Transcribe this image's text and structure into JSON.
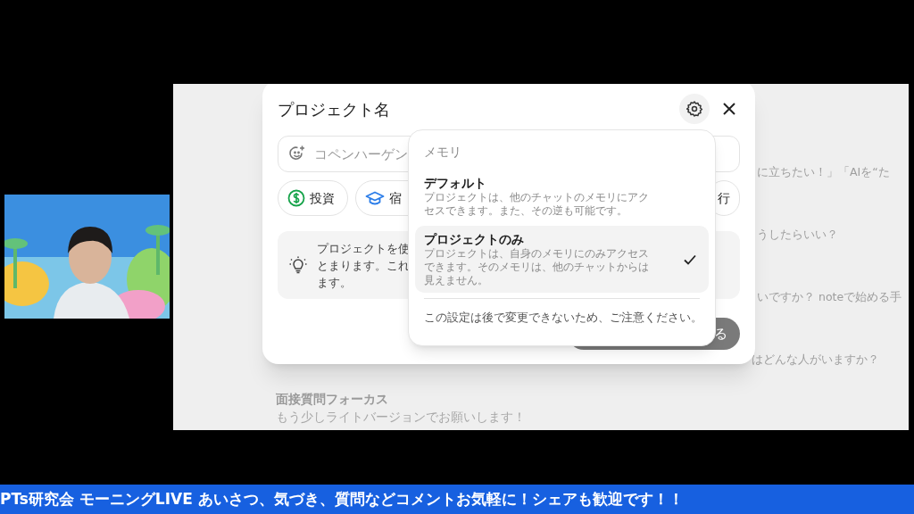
{
  "background": {
    "fragments": [
      "に立ちたい！」「AIを“た",
      "うしたらいい？",
      "いですか？ noteで始める手",
      "はどんな人がいますか？"
    ],
    "card": {
      "title": "面接質問フォーカス",
      "subtitle": "もう少しライトバージョンでお願いします！"
    }
  },
  "dialog": {
    "title": "プロジェクト名",
    "name_field": {
      "placeholder": "コペンハーゲン"
    },
    "chips": [
      {
        "kind": "money",
        "label": "投資"
      },
      {
        "kind": "school",
        "label": "宿"
      },
      {
        "kind": "plain",
        "label": "行"
      }
    ],
    "tip_lines": [
      "プロジェクトを使",
      "とまります。これ",
      "ます。"
    ],
    "create_button": "る"
  },
  "memory_menu": {
    "header": "メモリ",
    "options": [
      {
        "title": "デフォルト",
        "description": "プロジェクトは、他のチャットのメモリにアクセスできます。また、その逆も可能です。",
        "selected": false
      },
      {
        "title": "プロジェクトのみ",
        "description": "プロジェクトは、自身のメモリにのみアクセスできます。そのメモリは、他のチャットからは見えません。",
        "selected": true
      }
    ],
    "note": "この設定は後で変更できないため、ご注意ください。"
  },
  "ticker": "PTs研究会 モーニングLIVE あいさつ、気づき、質問などコメントお気軽に！シェアも歓迎です！！"
}
